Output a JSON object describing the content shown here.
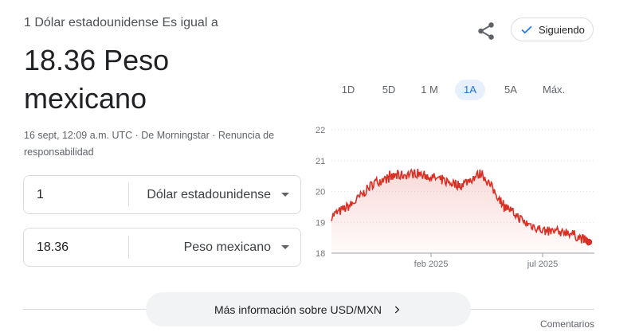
{
  "header": {
    "subtitle": "1 Dólar estadounidense Es igual a",
    "result": "18.36 Peso mexicano",
    "meta": "16 sept, 12:09 a.m. UTC · De Morningstar · Renuncia de responsabilidad",
    "follow_label": "Siguiendo"
  },
  "converter": {
    "from": {
      "amount": "1",
      "currency": "Dólar estadounidense"
    },
    "to": {
      "amount": "18.36",
      "currency": "Peso mexicano"
    }
  },
  "range_tabs": [
    "1D",
    "5D",
    "1 M",
    "1A",
    "5A",
    "Máx."
  ],
  "active_tab": "1A",
  "colors": {
    "line": "#d93025",
    "accent": "#1a73e8",
    "grid": "#dadce0"
  },
  "chart_data": {
    "type": "line",
    "title": "",
    "xlabel": "",
    "ylabel": "",
    "ylim": [
      18,
      22
    ],
    "yticks": [
      "22",
      "21",
      "20",
      "19",
      "18"
    ],
    "xticks": [
      "feb 2025",
      "jul 2025"
    ],
    "grid": true,
    "x": [
      "2024-09",
      "2024-10",
      "2024-11",
      "2024-12",
      "2025-01",
      "2025-02",
      "2025-03",
      "2025-04",
      "2025-05",
      "2025-06",
      "2025-07",
      "2025-08",
      "2025-09"
    ],
    "series": [
      {
        "values": [
          19.2,
          19.6,
          20.3,
          20.5,
          20.6,
          20.4,
          20.2,
          20.6,
          19.6,
          19.0,
          18.7,
          18.7,
          18.36
        ]
      }
    ],
    "last_value": 18.36
  },
  "more_info_label": "Más información sobre USD/MXN",
  "feedback_label": "Comentarios",
  "icons": {
    "share": "share-icon",
    "check": "check-icon",
    "chevron": "chevron-right-icon"
  }
}
